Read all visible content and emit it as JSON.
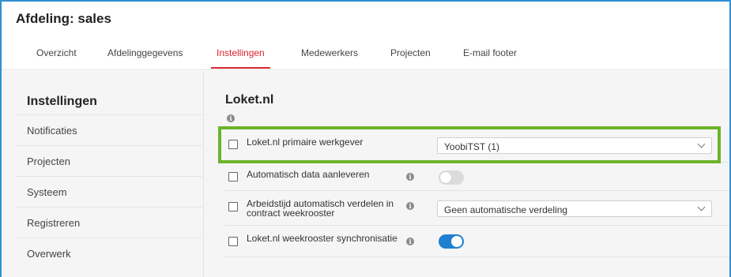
{
  "page": {
    "title": "Afdeling: sales"
  },
  "tabs": [
    {
      "label": "Overzicht",
      "active": false
    },
    {
      "label": "Afdelinggegevens",
      "active": false
    },
    {
      "label": "Instellingen",
      "active": true
    },
    {
      "label": "Medewerkers",
      "active": false
    },
    {
      "label": "Projecten",
      "active": false
    },
    {
      "label": "E-mail footer",
      "active": false
    }
  ],
  "sidebar": {
    "title": "Instellingen",
    "items": [
      {
        "label": "Notificaties"
      },
      {
        "label": "Projecten"
      },
      {
        "label": "Systeem"
      },
      {
        "label": "Registreren"
      },
      {
        "label": "Overwerk"
      }
    ]
  },
  "section": {
    "title": "Loket.nl",
    "info_icon": "info-icon",
    "rows": [
      {
        "label": "Loket.nl primaire werkgever",
        "checked": false,
        "control": "select",
        "value": "YoobiTST (1)",
        "highlighted": true
      },
      {
        "label": "Automatisch data aanleveren",
        "checked": false,
        "control": "toggle",
        "toggle_on": false
      },
      {
        "label_line1": "Arbeidstijd automatisch verdelen in",
        "label_line2": "contract weekrooster",
        "checked": false,
        "control": "select",
        "value": "Geen automatische verdeling"
      },
      {
        "label": "Loket.nl weekrooster synchronisatie",
        "checked": false,
        "control": "toggle",
        "toggle_on": true
      }
    ]
  },
  "colors": {
    "accent_red": "#d9262f",
    "toggle_on_blue": "#1f7fd1",
    "highlight_green": "#6bb42b",
    "frame_blue": "#2f8fd3"
  }
}
